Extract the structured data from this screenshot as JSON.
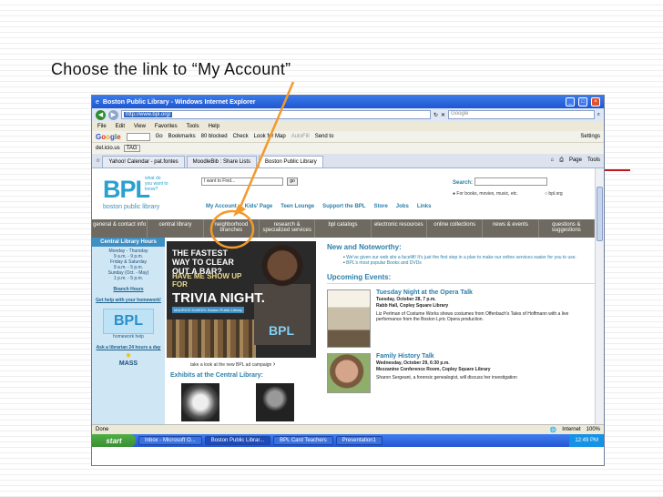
{
  "slide": {
    "instruction": "Choose the link to “My Account”"
  },
  "browser": {
    "window_title": "Boston Public Library - Windows Internet Explorer",
    "url": "http://www.bpl.org/",
    "search_placeholder": "Google",
    "menu": [
      "File",
      "Edit",
      "View",
      "Favorites",
      "Tools",
      "Help"
    ],
    "google_toolbar": [
      "Go",
      "Bookmarks",
      "80 blocked",
      "Check",
      "Look for Map",
      "AutoFill",
      "Send to",
      "Settings"
    ],
    "delicious": [
      "del.icio.us",
      "TAG"
    ],
    "tabs": [
      "Yahoo! Calendar - pat.fontes",
      "MoodleBib : Share Lists",
      "Boston Public Library"
    ],
    "tab_tools": [
      "Page",
      "Tools"
    ],
    "status_left": "Done",
    "status_zone": "Internet",
    "zoom": "100%"
  },
  "site": {
    "logo": "BPL",
    "tagline": "what do you want to know?",
    "name": "boston public library",
    "find_placeholder": "I want to Find...",
    "go": "go",
    "search_label": "Search:",
    "search_option": "For books, movies, music, etc.",
    "search_option2": "bpl.org",
    "top_links": [
      "My Account",
      "Kids' Page",
      "Teen Lounge",
      "Support the BPL",
      "Store",
      "Jobs",
      "Links"
    ],
    "nav": [
      "general & contact info",
      "central library",
      "neighborhood branches",
      "research & specialized services",
      "bpl catalogs",
      "electronic resources",
      "online collections",
      "news & events",
      "questions & suggestions"
    ],
    "left": {
      "hours_title": "Central Library Hours",
      "hours": [
        "Monday - Thursday",
        "9 a.m. - 9 p.m.",
        "Friday & Saturday",
        "9 a.m. - 5 p.m.",
        "Sunday (Oct. - May)",
        "1 p.m. - 5 p.m."
      ],
      "branch_hours": "Branch Hours",
      "get_help": "Get help with your homework!",
      "homework_logo": "BPL",
      "homework_caption": "homework help",
      "ask": "Ask a librarian 24 hours a day",
      "mass": "MASS"
    },
    "ad": {
      "line1": "THE FASTEST WAY TO CLEAR OUT A BAR?",
      "line2": "HAVE ME SHOW UP FOR",
      "line3": "TRIVIA NIGHT.",
      "badge": "MAURICE DUBOIS, Boston Public Library",
      "logo": "BPL",
      "logo_sub": "boston public library",
      "caption": "take a look at the new BPL ad campaign"
    },
    "exhibits_title": "Exhibits at the Central Library:",
    "news_title": "New and Noteworthy:",
    "news_items": [
      "We've given our web site a facelift! It's just the first step in a plan to make our online services easier for you to use.",
      "BPL's most popular Books and DVDs"
    ],
    "upcoming_title": "Upcoming Events:",
    "events": [
      {
        "title": "Tuesday Night at the Opera Talk",
        "date": "Tuesday, October 28, 7 p.m.",
        "place": "Rabb Hall, Copley Square Library",
        "desc": "Liz Perlman of Costume Works shows costumes from Offenbach's Tales of Hoffmann with a live performance from the Boston Lyric Opera production."
      },
      {
        "title": "Family History Talk",
        "date": "Wednesday, October 29, 6:30 p.m.",
        "place": "Mezzanine Conference Room, Copley Square Library",
        "desc": "Sharon Sergeant, a forensic genealogist, will discuss her investigation"
      }
    ]
  },
  "taskbar": {
    "start": "start",
    "buttons": [
      "Inbox - Microsoft O...",
      "Boston Public Librar...",
      "BPL Card Teachers",
      "Presentation1"
    ],
    "clock": "12:49 PM"
  },
  "colors": {
    "annotation": "#f39a2c",
    "rule": "#c4161c",
    "bpl_blue": "#2aa0cf"
  }
}
